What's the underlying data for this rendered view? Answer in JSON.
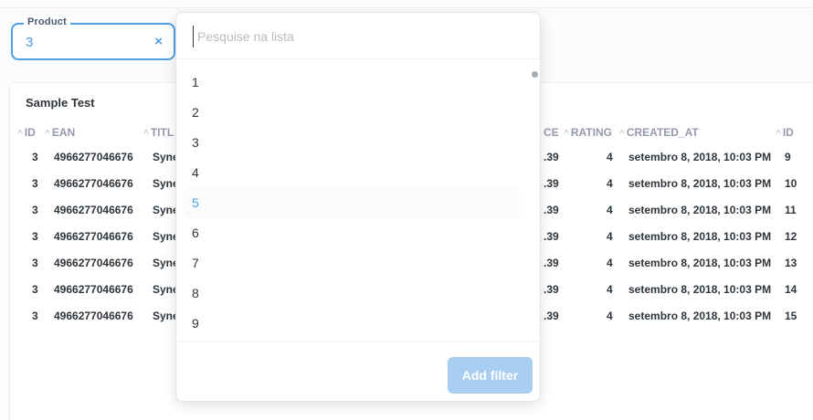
{
  "filter": {
    "label": "Product",
    "value": "3",
    "clear_icon": "×"
  },
  "card": {
    "title": "Sample Test"
  },
  "table": {
    "columns": [
      {
        "label": "ID"
      },
      {
        "label": "EAN"
      },
      {
        "label": "TITL"
      },
      {
        "label": "CE"
      },
      {
        "label": "RATING"
      },
      {
        "label": "CREATED_AT"
      },
      {
        "label": "ID"
      }
    ],
    "rows": [
      {
        "id": "3",
        "ean": "4966277046676",
        "title": "Syne",
        "price": ".39",
        "rating": "4",
        "created_at": "setembro 8, 2018, 10:03 PM",
        "id2": "9"
      },
      {
        "id": "3",
        "ean": "4966277046676",
        "title": "Syne",
        "price": ".39",
        "rating": "4",
        "created_at": "setembro 8, 2018, 10:03 PM",
        "id2": "10"
      },
      {
        "id": "3",
        "ean": "4966277046676",
        "title": "Syne",
        "price": ".39",
        "rating": "4",
        "created_at": "setembro 8, 2018, 10:03 PM",
        "id2": "11"
      },
      {
        "id": "3",
        "ean": "4966277046676",
        "title": "Syne",
        "price": ".39",
        "rating": "4",
        "created_at": "setembro 8, 2018, 10:03 PM",
        "id2": "12"
      },
      {
        "id": "3",
        "ean": "4966277046676",
        "title": "Syne",
        "price": ".39",
        "rating": "4",
        "created_at": "setembro 8, 2018, 10:03 PM",
        "id2": "13"
      },
      {
        "id": "3",
        "ean": "4966277046676",
        "title": "Syne",
        "price": ".39",
        "rating": "4",
        "created_at": "setembro 8, 2018, 10:03 PM",
        "id2": "14"
      },
      {
        "id": "3",
        "ean": "4966277046676",
        "title": "Syne",
        "price": ".39",
        "rating": "4",
        "created_at": "setembro 8, 2018, 10:03 PM",
        "id2": "15"
      }
    ]
  },
  "popover": {
    "search_placeholder": "Pesquise na lista",
    "options": [
      "1",
      "2",
      "3",
      "4",
      "5",
      "6",
      "7",
      "8",
      "9"
    ],
    "selected_option": "5",
    "add_button_label": "Add filter"
  },
  "colors": {
    "accent": "#509ee3",
    "button_disabled": "#a8cff2"
  }
}
